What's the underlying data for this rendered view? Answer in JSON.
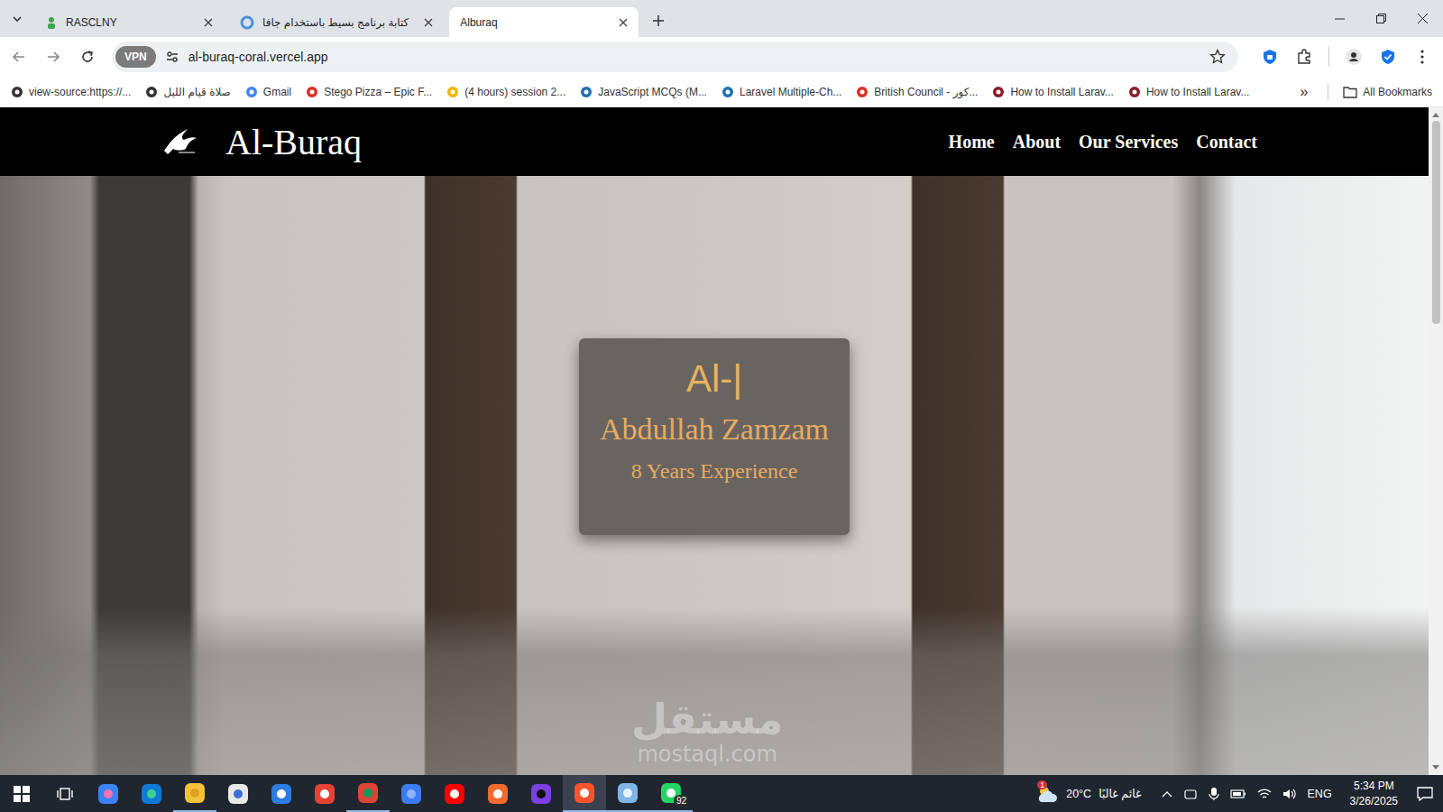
{
  "browser": {
    "tabs": [
      {
        "label": "RASCLNY",
        "selected": false
      },
      {
        "label": "كتابة برنامج بسيط باستخدام جافا",
        "selected": false
      },
      {
        "label": "Alburaq",
        "selected": true
      }
    ],
    "vpn": "VPN",
    "url": "al-buraq-coral.vercel.app",
    "bookmarks": [
      "view-source:https://...",
      "صلاة قيام الليل",
      "Gmail",
      "Stego Pizza – Epic F...",
      "(4 hours) session 2...",
      "JavaScript MCQs (M...",
      "Laravel Multiple-Ch...",
      "British Council - كور...",
      "How to Install Larav...",
      "How to Install Larav..."
    ],
    "more_bookmarks": "»",
    "all_bookmarks": "All Bookmarks"
  },
  "site": {
    "brand": "Al-Buraq",
    "nav": [
      "Home",
      "About",
      "Our Services",
      "Contact"
    ],
    "hero": {
      "typed": "Al-|",
      "name": "Abdullah Zamzam",
      "experience": "8 Years Experience"
    }
  },
  "watermark": {
    "arabic": "مستقل",
    "latin": "mostaql.com"
  },
  "taskbar": {
    "apps": [
      {
        "running": false,
        "focused": false
      },
      {
        "running": false,
        "focused": false
      },
      {
        "running": true,
        "focused": false
      },
      {
        "running": false,
        "focused": false
      },
      {
        "running": false,
        "focused": false
      },
      {
        "running": false,
        "focused": false
      },
      {
        "running": true,
        "focused": false
      },
      {
        "running": false,
        "focused": false
      },
      {
        "running": false,
        "focused": false
      },
      {
        "running": false,
        "focused": false
      },
      {
        "running": false,
        "focused": false
      },
      {
        "running": true,
        "focused": true
      },
      {
        "running": true,
        "focused": false
      },
      {
        "running": true,
        "focused": false,
        "badge": "92"
      }
    ],
    "weather": {
      "temp": "20°C",
      "condition": "غائم غالبًا",
      "badge": "1"
    },
    "language": "ENG",
    "time": "5:34 PM",
    "date": "3/26/2025"
  }
}
